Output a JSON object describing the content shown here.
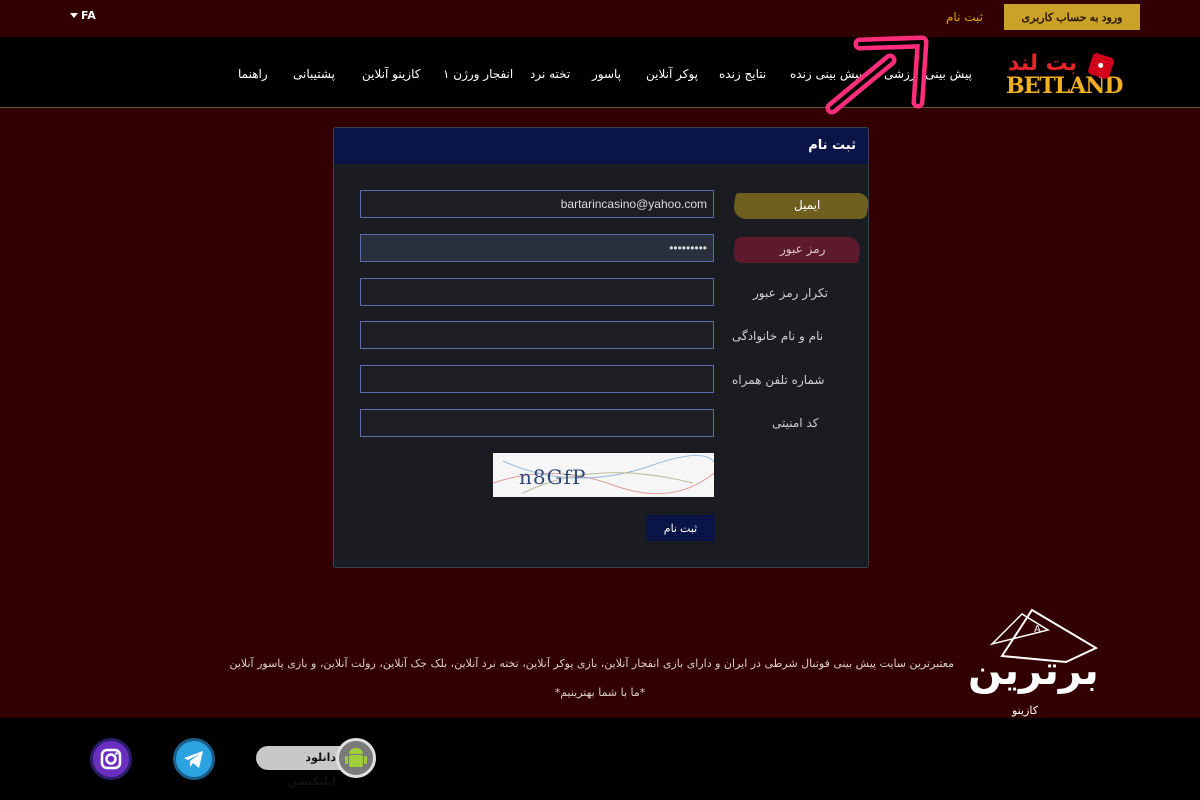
{
  "topbar": {
    "language": "FA",
    "login_button": "ورود به حساب کاربری",
    "register_link": "ثبت نام"
  },
  "logo": {
    "fa_text": "بت لند",
    "en_text": "BETLAND"
  },
  "nav": {
    "items": [
      "پیش بینی ورزشی",
      "پیش بینی زنده",
      "نتایج زنده",
      "پوکر آنلاین",
      "پاسور",
      "تخته نرد",
      "انفجار ورژن ۱",
      "کازینو آنلاین",
      "پشتیبانی",
      "راهنما"
    ]
  },
  "form": {
    "title": "ثبت نام",
    "fields": [
      {
        "label": "ایمیل",
        "value": "bartarincasino@yahoo.com"
      },
      {
        "label": "رمز عبور",
        "value": "•••••••••"
      },
      {
        "label": "تکرار رمز عبور",
        "value": ""
      },
      {
        "label": "نام و نام خانوادگی",
        "value": ""
      },
      {
        "label": "شماره تلفن همراه",
        "value": ""
      },
      {
        "label": "کد امنیتی",
        "value": ""
      }
    ],
    "captcha_text": "n8GfP",
    "submit_label": "ثبت نام"
  },
  "footer": {
    "description": "معتبرترین سایت پیش بینی فوتبال شرطی در ایران و دارای بازی انفجار آنلاین، بازی پوکر آنلاین، تخته نرد آنلاین، بلک جک آنلاین، رولت آنلاین، و بازی پاسور آنلاین",
    "tagline": "*ما با شما بهترینیم*"
  },
  "brand": {
    "main": "برترین",
    "sub": "کازینو"
  },
  "app": {
    "download_label": "دانلود اپلیکیشن"
  },
  "colors": {
    "background": "#320000",
    "gold": "#c9a227",
    "panel_header": "#0a1446",
    "arrow": "#ff2d7a"
  }
}
